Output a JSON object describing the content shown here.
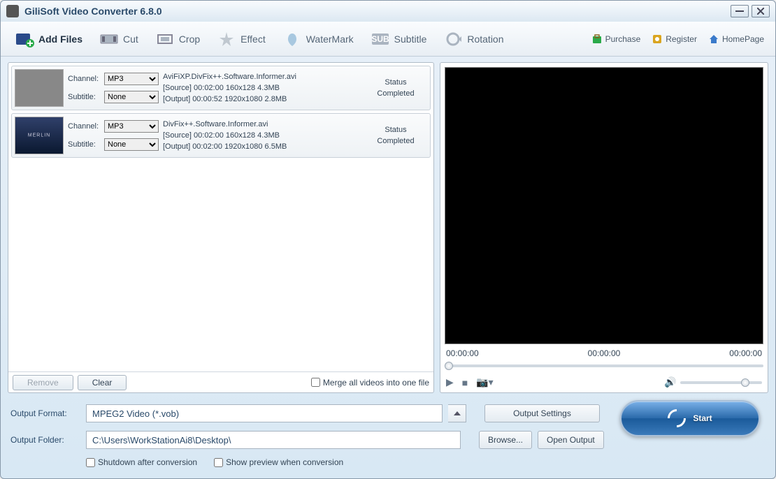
{
  "title": "GiliSoft Video Converter 6.8.0",
  "toolbar": {
    "addfiles": "Add Files",
    "cut": "Cut",
    "crop": "Crop",
    "effect": "Effect",
    "watermark": "WaterMark",
    "subtitle": "Subtitle",
    "rotation": "Rotation",
    "purchase": "Purchase",
    "register": "Register",
    "homepage": "HomePage"
  },
  "labels": {
    "channel": "Channel:",
    "subtitle": "Subtitle:",
    "status": "Status",
    "remove": "Remove",
    "clear": "Clear",
    "merge": "Merge all videos into one file",
    "output_format": "Output Format:",
    "output_folder": "Output Folder:",
    "output_settings": "Output Settings",
    "browse": "Browse...",
    "open_output": "Open Output",
    "shutdown": "Shutdown after conversion",
    "show_preview": "Show preview when conversion",
    "start": "Start"
  },
  "files": [
    {
      "channel": "MP3",
      "subtitle": "None",
      "name": "AviFiXP.DivFix++.Software.Informer.avi",
      "source": "[Source]  00:02:00  160x128  4.3MB",
      "output": "[Output]  00:00:52  1920x1080  2.8MB",
      "status": "Completed"
    },
    {
      "channel": "MP3",
      "subtitle": "None",
      "name": "DivFix++.Software.Informer.avi",
      "source": "[Source]  00:02:00  160x128  4.3MB",
      "output": "[Output]  00:02:00  1920x1080  6.5MB",
      "status": "Completed"
    }
  ],
  "preview": {
    "t0": "00:00:00",
    "t1": "00:00:00",
    "t2": "00:00:00"
  },
  "output": {
    "format": "MPEG2 Video (*.vob)",
    "folder": "C:\\Users\\WorkStationAi8\\Desktop\\"
  }
}
